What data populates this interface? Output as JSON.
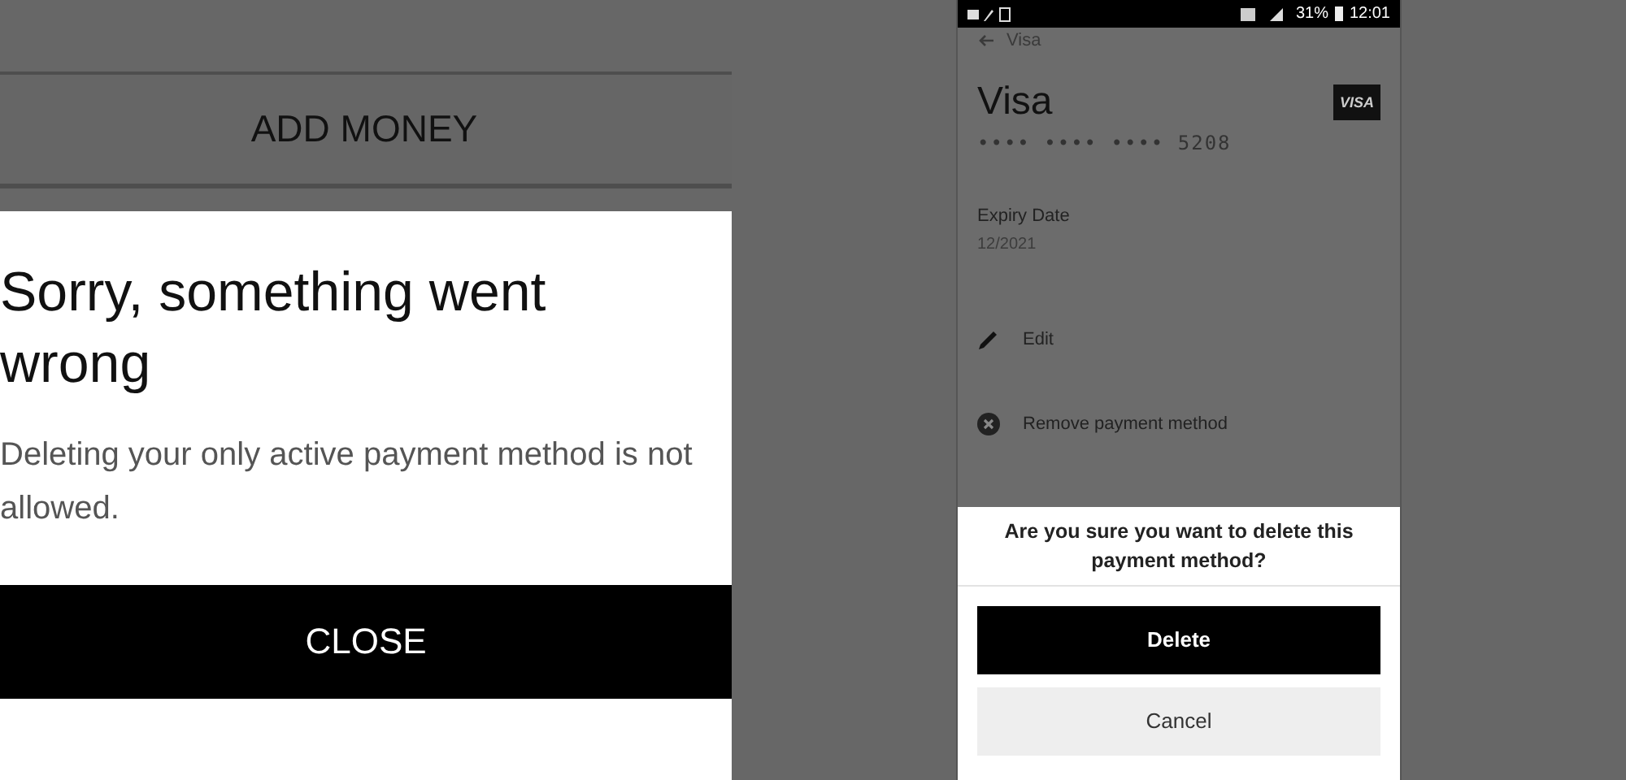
{
  "left": {
    "add_money_button": "ADD MONEY",
    "dialog": {
      "title": "Sorry, something went wrong",
      "message": "Deleting your only active payment method is not allowed.",
      "close_button": "CLOSE"
    }
  },
  "phone": {
    "status_bar": {
      "battery": "31%",
      "time": "12:01"
    },
    "header": {
      "title": "Visa"
    },
    "card": {
      "name": "Visa",
      "brand_badge": "VISA",
      "number": "•••• •••• •••• 5208"
    },
    "expiry": {
      "label": "Expiry Date",
      "value": "12/2021"
    },
    "actions": [
      {
        "kind": "edit",
        "label": "Edit"
      },
      {
        "kind": "remove",
        "label": "Remove payment method"
      }
    ],
    "sheet": {
      "question": "Are you sure you want to delete this payment method?",
      "buttons": [
        {
          "kind": "primary",
          "label": "Delete"
        },
        {
          "kind": "secondary",
          "label": "Cancel"
        }
      ]
    }
  }
}
